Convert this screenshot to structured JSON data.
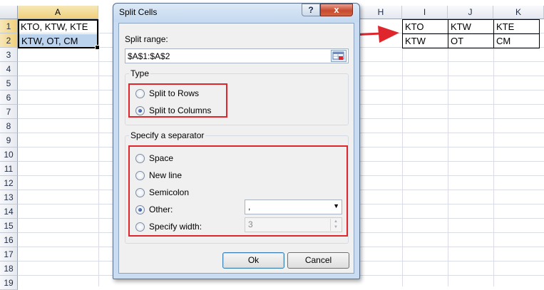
{
  "sheet": {
    "columns": [
      {
        "id": "A",
        "label": "A"
      },
      {
        "id": "H",
        "label": "H"
      },
      {
        "id": "I",
        "label": "I"
      },
      {
        "id": "J",
        "label": "J"
      },
      {
        "id": "K",
        "label": "K"
      }
    ],
    "rows": [
      "1",
      "2",
      "3",
      "4",
      "5",
      "6",
      "7",
      "8",
      "9",
      "10",
      "11",
      "12",
      "13",
      "14",
      "15",
      "16",
      "17",
      "18",
      "19"
    ],
    "source": {
      "a1": "KTO, KTW, KTE",
      "a2": "KTW, OT, CM"
    },
    "output": {
      "row1": [
        "KTO",
        "KTW",
        "KTE"
      ],
      "row2": [
        "KTW",
        "OT",
        "CM"
      ]
    }
  },
  "dialog": {
    "title": "Split Cells",
    "help_label": "?",
    "close_label": "x",
    "split_range_label": "Split range:",
    "split_range_value": "$A$1:$A$2",
    "type_group_label": "Type",
    "type_options": {
      "rows": "Split to Rows",
      "columns": "Split to Columns",
      "selected": "columns"
    },
    "separator_group_label": "Specify a separator",
    "separator_options": {
      "space": "Space",
      "new_line": "New line",
      "semicolon": "Semicolon",
      "other": "Other:",
      "specify_width": "Specify width:",
      "selected": "other"
    },
    "other_value": ",",
    "width_value": "3",
    "ok_label": "Ok",
    "cancel_label": "Cancel"
  },
  "colors": {
    "highlight_red": "#e0262d",
    "selection_blue": "#bcd3ee",
    "dialog_frame": "#c9dcf2"
  }
}
